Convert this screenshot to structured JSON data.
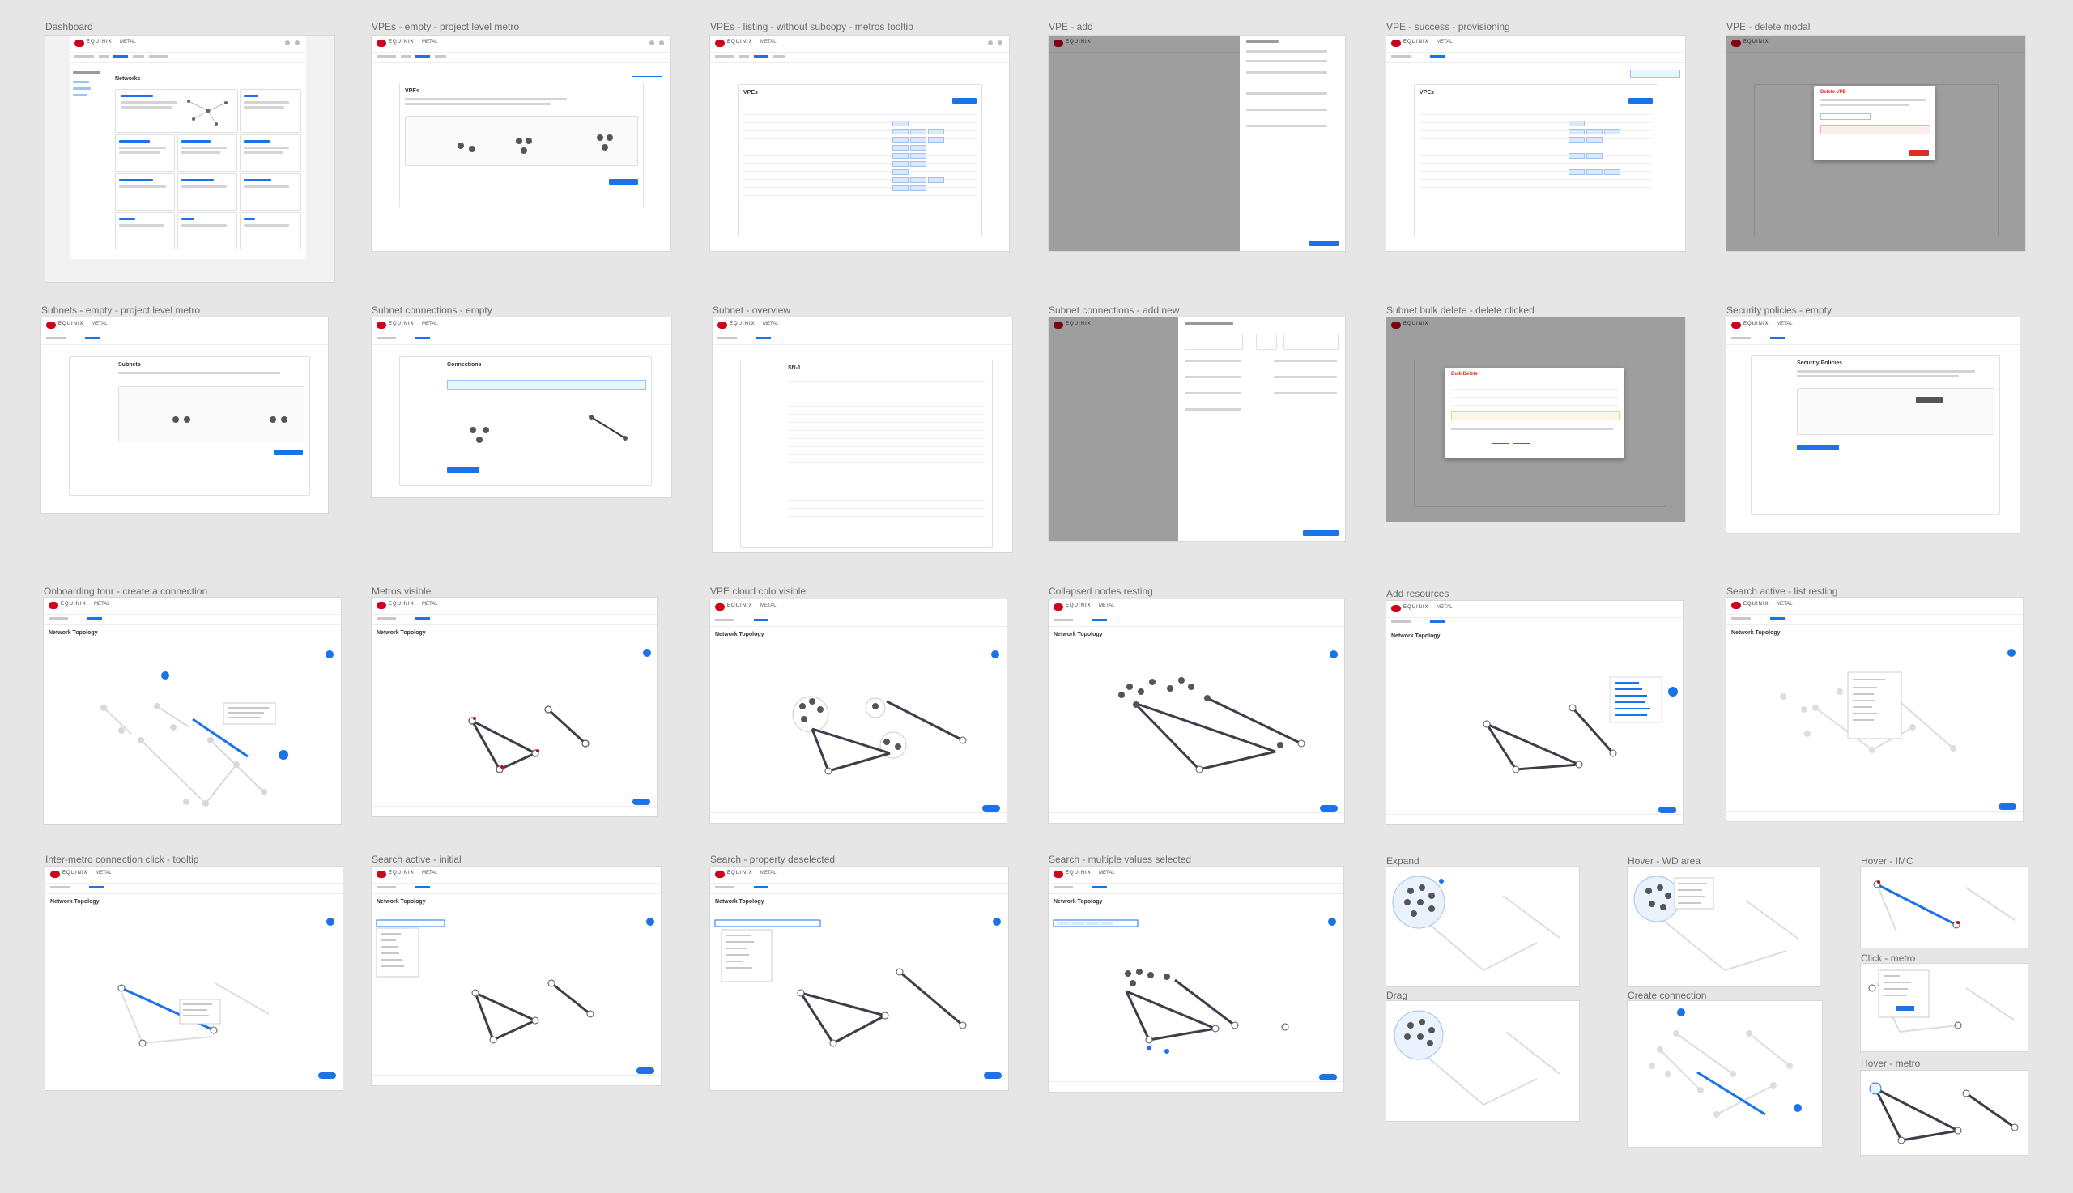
{
  "frames": [
    {
      "label": "Dashboard"
    },
    {
      "label": "VPEs - empty - project level metro"
    },
    {
      "label": "VPEs - listing - without subcopy - metros tooltip"
    },
    {
      "label": "VPE - add"
    },
    {
      "label": "VPE - success - provisioning"
    },
    {
      "label": "VPE - delete modal"
    },
    {
      "label": "Subnets - empty - project level metro"
    },
    {
      "label": "Subnet connections - empty"
    },
    {
      "label": "Subnet - overview"
    },
    {
      "label": "Subnet connections - add new"
    },
    {
      "label": "Subnet bulk delete - delete clicked"
    },
    {
      "label": "Security policies - empty"
    },
    {
      "label": "Onboarding tour - create a connection"
    },
    {
      "label": "Metros visible"
    },
    {
      "label": "VPE cloud colo visible"
    },
    {
      "label": "Collapsed nodes resting"
    },
    {
      "label": "Add resources"
    },
    {
      "label": "Search active - list resting"
    },
    {
      "label": "Inter-metro connection click - tooltip"
    },
    {
      "label": "Search active - initial"
    },
    {
      "label": "Search - property deselected"
    },
    {
      "label": "Search - multiple values selected"
    },
    {
      "label": "Expand"
    },
    {
      "label": "Hover - WD area"
    },
    {
      "label": "Hover - IMC"
    },
    {
      "label": "Click - metro"
    },
    {
      "label": "Hover - metro"
    },
    {
      "label": "Drag"
    },
    {
      "label": "Create connection"
    }
  ],
  "app": {
    "brand": "EQUINIX",
    "product": "METAL",
    "page_networks": "Networks",
    "page_topology": "Network Topology",
    "page_vpes": "VPEs",
    "page_subnets": "Subnets",
    "page_connections": "Connections",
    "page_subnet": "SN-1",
    "page_security": "Security Policies",
    "modal_delete_vpe": "Delete VPE",
    "modal_bulk_delete": "Bulk Delete"
  },
  "colors": {
    "canvas": "#e6e6e6",
    "accent": "#1a73e8",
    "brand_red": "#d0021b",
    "danger": "#d93025",
    "topo_edge": "#3b3f4a",
    "topo_edge_highlight": "#1a73e8"
  }
}
